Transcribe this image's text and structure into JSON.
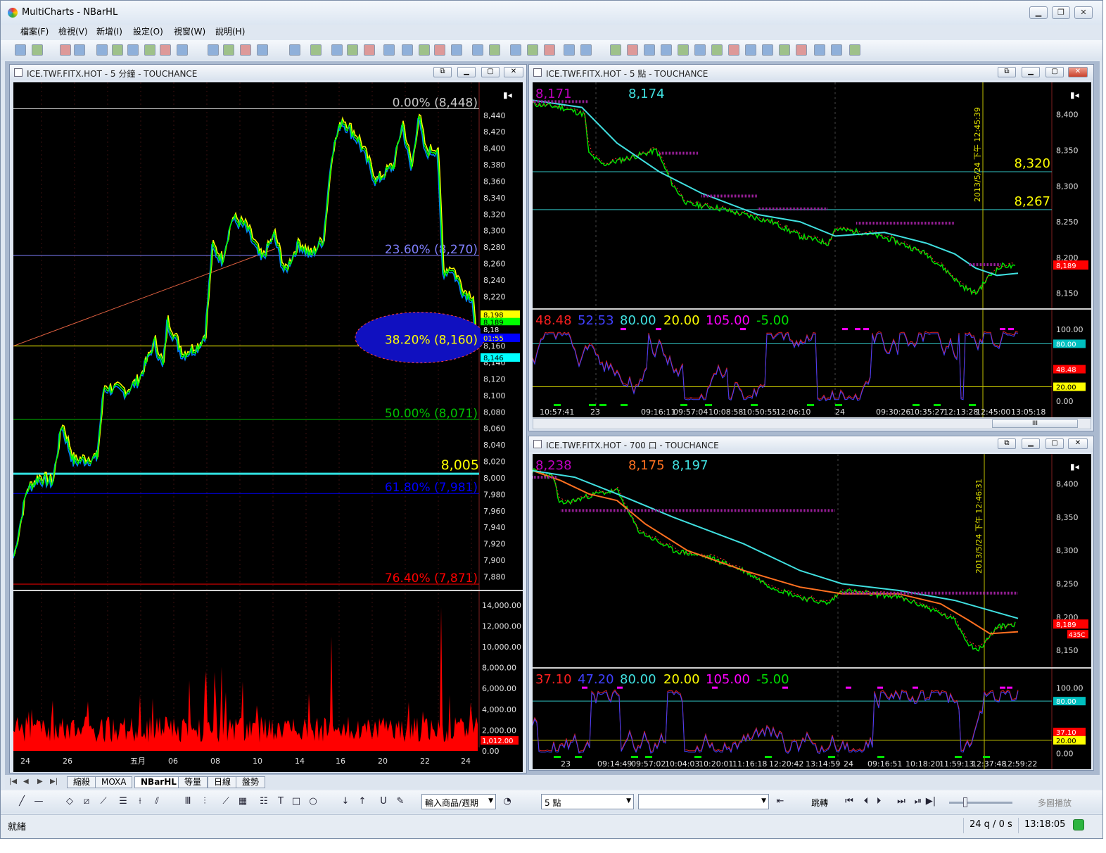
{
  "app": {
    "title": "MultiCharts - NBarHL"
  },
  "menu": [
    "檔案(F)",
    "檢視(V)",
    "新增(I)",
    "設定(O)",
    "視窗(W)",
    "說明(H)"
  ],
  "left_chart": {
    "title": "ICE.TWF.FITX.HOT - 5 分鐘 - TOUCHANCE",
    "price_axis": [
      "8,440",
      "8,420",
      "8,400",
      "8,380",
      "8,360",
      "8,340",
      "8,320",
      "8,300",
      "8,280",
      "8,260",
      "8,240",
      "8,220",
      "8,200",
      "8,180",
      "8,160",
      "8,140",
      "8,120",
      "8,100",
      "8,080",
      "8,060",
      "8,040",
      "8,020",
      "8,000",
      "7,980",
      "7,960",
      "7,940",
      "7,920",
      "7,900",
      "7,880"
    ],
    "fib": [
      {
        "label": "0.00% (8,448)",
        "price": 8448,
        "color": "#c8c8c8"
      },
      {
        "label": "23.60% (8,270)",
        "price": 8270,
        "color": "#8080ff"
      },
      {
        "label": "38.20% (8,160)",
        "price": 8160,
        "color": "#ffff00"
      },
      {
        "label": "50.00% (8,071)",
        "price": 8071,
        "color": "#00c000"
      },
      {
        "label": "61.80% (7,981)",
        "price": 7981,
        "color": "#0000ff"
      },
      {
        "label": "76.40% (7,871)",
        "price": 7871,
        "color": "#ff0000"
      }
    ],
    "level_8005": "8,005",
    "price_tags": [
      "8,198",
      "8,189",
      "8,18",
      "01:55",
      "8,146"
    ],
    "volume_axis": [
      "14,000.00",
      "12,000.00",
      "10,000.00",
      "8,000.00",
      "6,000.00",
      "4,000.00",
      "2,000.00",
      "0.00"
    ],
    "volume_tag": "1,012.00",
    "date_axis": [
      "24",
      "26",
      "五月",
      "06",
      "08",
      "10",
      "14",
      "16",
      "20",
      "22",
      "24"
    ]
  },
  "chart_tr": {
    "title": "ICE.TWF.FITX.HOT - 5 點 - TOUCHANCE",
    "readout": [
      "8,171",
      "8,174"
    ],
    "price_axis": [
      "8,400",
      "8,350",
      "8,300",
      "8,250",
      "8,200",
      "8,150"
    ],
    "levels": [
      "8,320",
      "8,267"
    ],
    "last_tag": "8,189",
    "vline_label": "2013/5/24 下午 12:45:39",
    "osc_readout": [
      "48.48",
      "52.53",
      "80.00",
      "20.00",
      "105.00",
      "-5.00"
    ],
    "osc_axis": [
      "100.00",
      "0.00"
    ],
    "osc_tags": [
      "80.00",
      "48.48",
      "20.00"
    ],
    "time_axis": [
      "10:57:41",
      "23",
      "09:16:11",
      "09:57:04",
      "10:08:58",
      "10:50:55",
      "12:06:10",
      "24",
      "09:30:26",
      "10:35:27",
      "12:13:28",
      "12:45:00",
      "13:05:18"
    ]
  },
  "chart_br": {
    "title": "ICE.TWF.FITX.HOT - 700 口 - TOUCHANCE",
    "readout": [
      "8,238",
      "8,175",
      "8,197"
    ],
    "price_axis": [
      "8,400",
      "8,350",
      "8,300",
      "8,250",
      "8,200",
      "8,150"
    ],
    "last_tag": "8,189",
    "last_tag2": "435C",
    "vline_label": "2013/5/24 下午 12:46:31",
    "osc_readout": [
      "37.10",
      "47.20",
      "80.00",
      "20.00",
      "105.00",
      "-5.00"
    ],
    "osc_axis": [
      "100.00",
      "0.00"
    ],
    "osc_tags": [
      "80.00",
      "37.10",
      "20.00"
    ],
    "time_axis": [
      "23",
      "09:14:49",
      "09:57:02",
      "10:04:03",
      "10:20:01",
      "11:16:18",
      "12:20:42",
      "13:14:59",
      "24",
      "09:16:51",
      "10:18:20",
      "11:59:13",
      "12:37:48",
      "12:59:22"
    ]
  },
  "workspace_tabs": [
    "縮殺",
    "MOXA",
    "NBarHL",
    "等量",
    "日線",
    "盤勢"
  ],
  "workspace_active": "NBarHL",
  "drawbar": {
    "symbol_combo": "輸入商品/週期",
    "period_combo": "5 點",
    "jump_label": "跳轉",
    "multi_play": "多圖播放"
  },
  "status": {
    "ready": "就緒",
    "rate": "24 q / 0 s",
    "time": "13:18:05"
  },
  "colors": {
    "price_green": "#00ff00",
    "price_yellow": "#ffff00",
    "price_blue": "#0070ff",
    "ma_cyan": "#40e0e0",
    "ma_orange": "#ff7a20",
    "volume": "#ff0000",
    "osc": "#5050ff"
  }
}
